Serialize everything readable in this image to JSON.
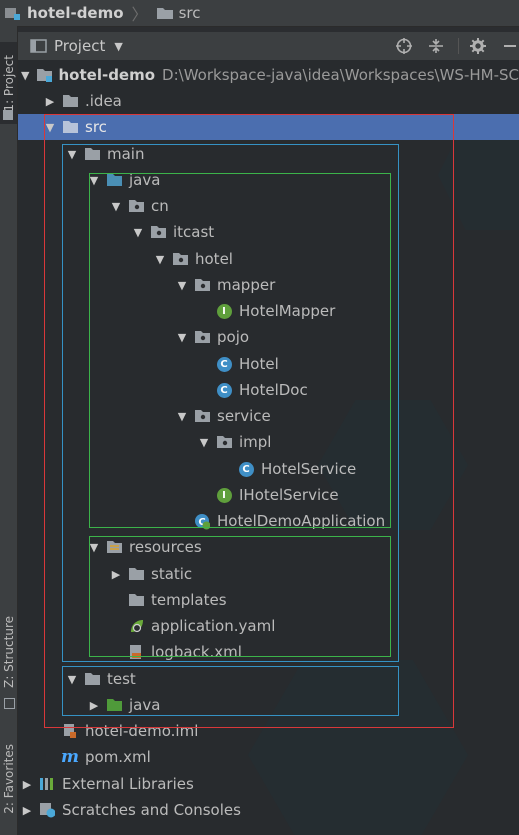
{
  "breadcrumb": {
    "project": "hotel-demo",
    "folder": "src"
  },
  "side_tabs": {
    "project": "1: Project",
    "structure": "Z: Structure",
    "favorites": "2: Favorites"
  },
  "panel": {
    "title": "Project"
  },
  "tree": {
    "root": {
      "label": "hotel-demo",
      "path": "D:\\Workspace-java\\idea\\Workspaces\\WS-HM-SC"
    },
    "idea": ".idea",
    "src": "src",
    "main": "main",
    "java": "java",
    "cn": "cn",
    "itcast": "itcast",
    "hotel": "hotel",
    "mapper": "mapper",
    "hotel_mapper": "HotelMapper",
    "pojo": "pojo",
    "hotel_class": "Hotel",
    "hotel_doc": "HotelDoc",
    "service": "service",
    "impl": "impl",
    "hotel_service": "HotelService",
    "ihotel_service": "IHotelService",
    "app": "HotelDemoApplication",
    "resources": "resources",
    "static": "static",
    "templates": "templates",
    "application_yaml": "application.yaml",
    "logback": "logback.xml",
    "test": "test",
    "test_java": "java",
    "iml": "hotel-demo.iml",
    "pom": "pom.xml",
    "ext_libs": "External Libraries",
    "scratches": "Scratches and Consoles"
  },
  "colors": {
    "selection": "#4b6eaf",
    "red_box": "#d9383a",
    "blue_box": "#3592c4",
    "green_box": "#3cb34a"
  }
}
